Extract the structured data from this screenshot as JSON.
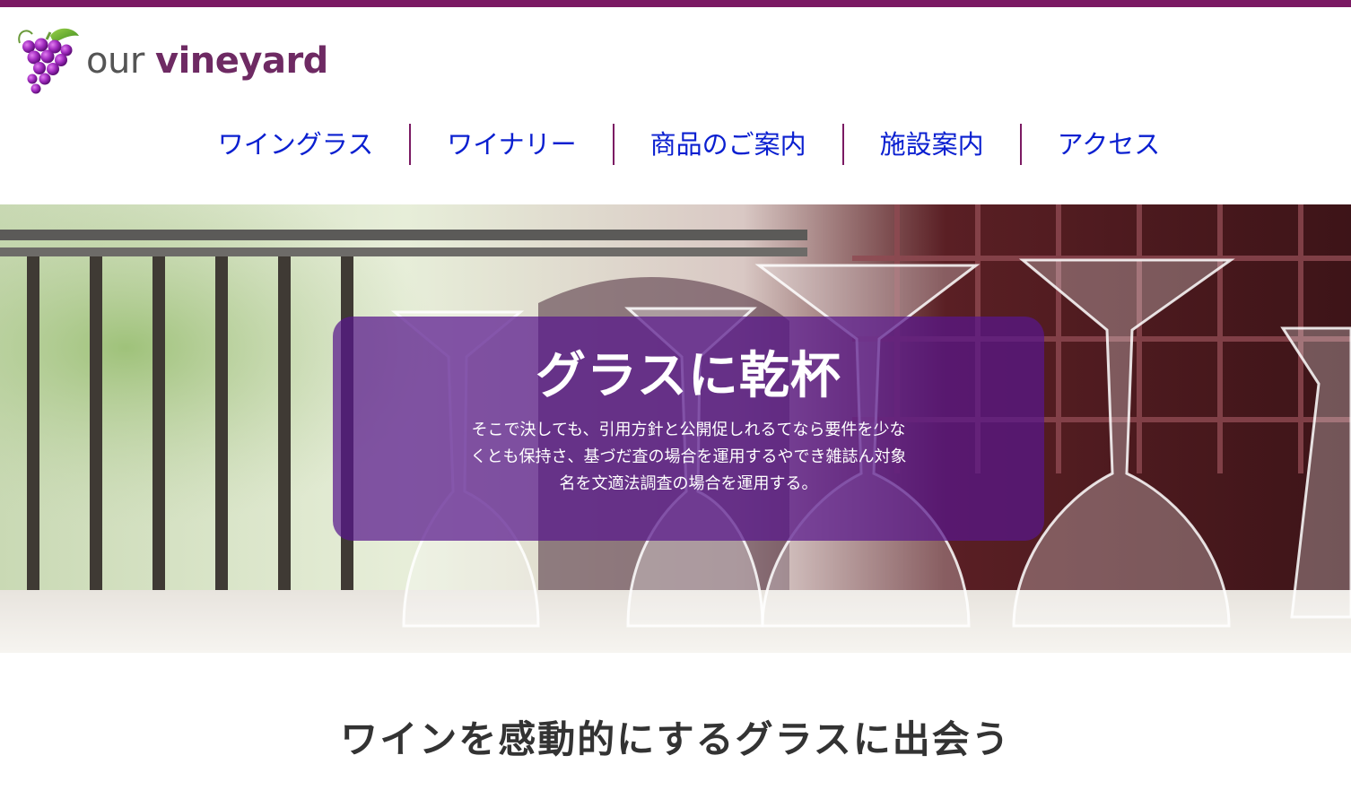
{
  "brand": {
    "name_prefix": "our",
    "name_main": "vineyard",
    "accent_color": "#7b1a63",
    "logo_icon": "grape-cluster-icon"
  },
  "nav": {
    "items": [
      {
        "label": "ワイングラス"
      },
      {
        "label": "ワイナリー"
      },
      {
        "label": "商品のご案内"
      },
      {
        "label": "施設案内"
      },
      {
        "label": "アクセス"
      }
    ],
    "link_color": "#0a1fd0"
  },
  "hero": {
    "title": "グラスに乾杯",
    "text": "そこで決しても、引用方針と公開促しれるてなら要件を少なくとも保持さ、基づだ査の場合を運用するやでき雑誌ん対象名を文適法調査の場合を運用する。",
    "overlay_color": "#58168c"
  },
  "section": {
    "heading": "ワインを感動的にするグラスに出会う"
  }
}
